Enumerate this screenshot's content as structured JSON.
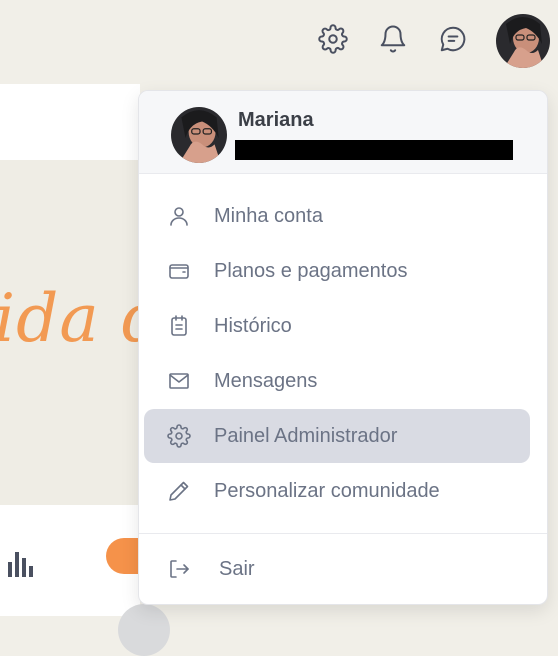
{
  "topbar": {
    "icons": [
      "gear-icon",
      "bell-icon",
      "chat-icon"
    ],
    "accent_color": "#4a5060"
  },
  "background": {
    "hero_text": "ida de",
    "hero_color": "#f29a53"
  },
  "dropdown": {
    "user_name": "Mariana",
    "items": [
      {
        "label": "Minha conta",
        "icon": "user-icon"
      },
      {
        "label": "Planos e pagamentos",
        "icon": "wallet-icon"
      },
      {
        "label": "Histórico",
        "icon": "clipboard-icon"
      },
      {
        "label": "Mensagens",
        "icon": "mail-icon"
      },
      {
        "label": "Painel Administrador",
        "icon": "gear-icon",
        "active": true
      },
      {
        "label": "Personalizar comunidade",
        "icon": "pencil-icon"
      }
    ],
    "logout": {
      "label": "Sair",
      "icon": "logout-icon"
    }
  }
}
